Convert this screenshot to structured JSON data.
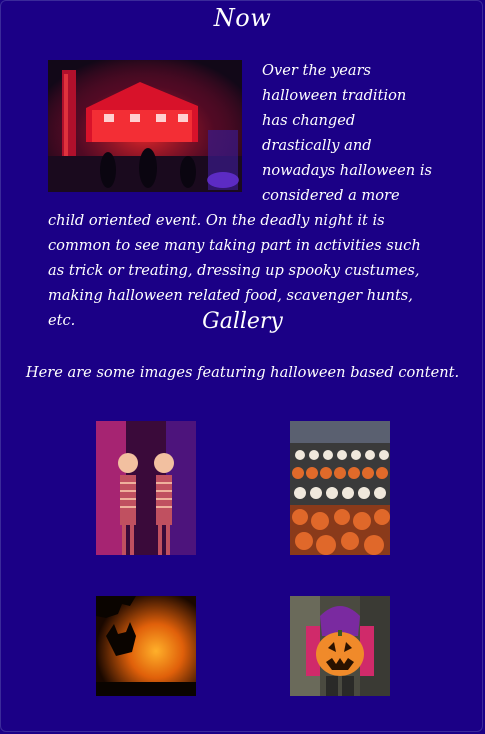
{
  "now": {
    "title": "Now",
    "paragraph": "Over the years halloween tradition has changed drastically and nowadays halloween is considered a more child oriented event. On the deadly night it is common to see many taking part in activities such as trick or treating, dressing up spooky custumes, making halloween related food, scavenger hunts, etc."
  },
  "gallery": {
    "title": "Gallery",
    "subtitle": "Here are some images featuring halloween based content."
  },
  "colors": {
    "background": "#1b0086",
    "text": "#ffffff"
  }
}
